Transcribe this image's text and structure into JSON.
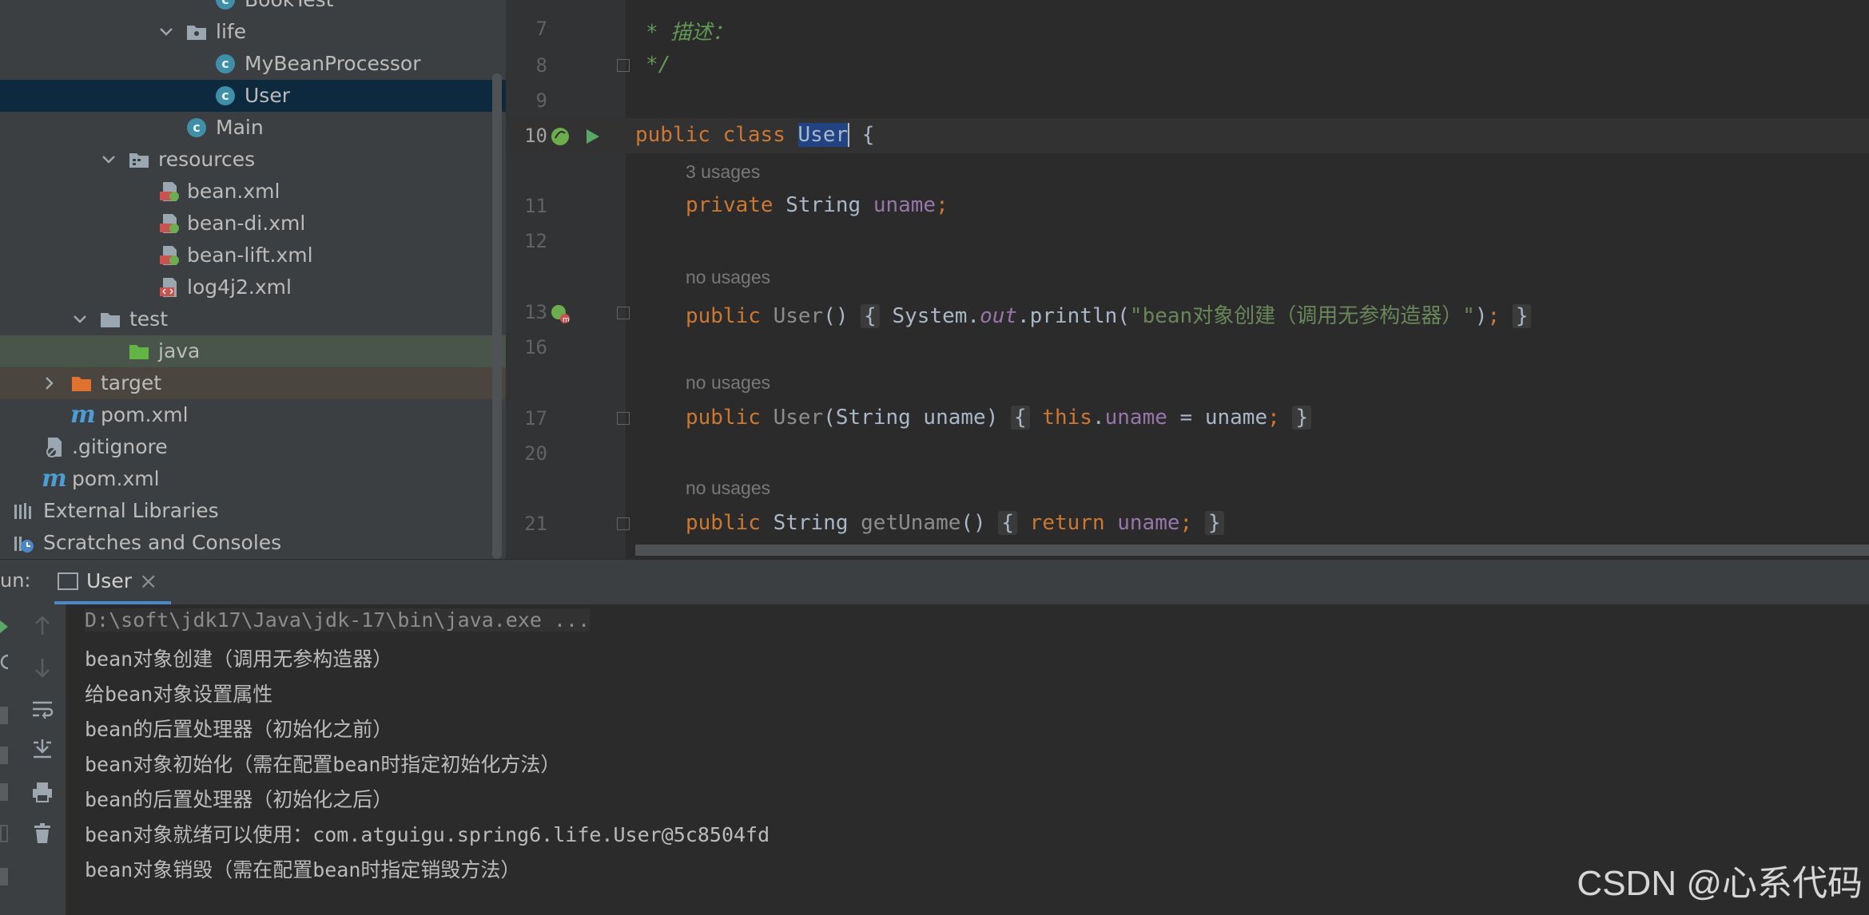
{
  "project_tree": [
    {
      "label": "BookTest",
      "type": "class"
    },
    {
      "label": "life",
      "type": "package",
      "expanded": true
    },
    {
      "label": "MyBeanProcessor",
      "type": "class"
    },
    {
      "label": "User",
      "type": "class",
      "selected": true
    },
    {
      "label": "Main",
      "type": "class"
    },
    {
      "label": "resources",
      "type": "resources-folder",
      "expanded": true
    },
    {
      "label": "bean.xml",
      "type": "spring-xml"
    },
    {
      "label": "bean-di.xml",
      "type": "spring-xml"
    },
    {
      "label": "bean-lift.xml",
      "type": "spring-xml"
    },
    {
      "label": "log4j2.xml",
      "type": "xml"
    },
    {
      "label": "test",
      "type": "folder",
      "expanded": true
    },
    {
      "label": "java",
      "type": "test-source-folder"
    },
    {
      "label": "target",
      "type": "excluded-folder",
      "expanded": false
    },
    {
      "label": "pom.xml",
      "type": "maven"
    },
    {
      "label": ".gitignore",
      "type": "gitignore"
    },
    {
      "label": "pom.xml",
      "type": "maven"
    },
    {
      "label": "External Libraries",
      "type": "libraries"
    },
    {
      "label": "Scratches and Consoles",
      "type": "scratches"
    }
  ],
  "editor": {
    "comment_line1": "* 描述：",
    "comment_line2": "*/",
    "class_decl": {
      "kw1": "public",
      "kw2": "class",
      "name": "User",
      "brace": " {"
    },
    "hints": {
      "usages3": "3 usages",
      "no_usages": "no usages"
    },
    "field_decl": {
      "kw": "private",
      "type": "String",
      "name": "uname",
      "semi": ";"
    },
    "ctor1": {
      "kw": "public",
      "name": "User",
      "params": "()",
      "open": "{",
      "body_obj": "System.",
      "body_field": "out",
      "body_call": ".println(",
      "body_str": "\"bean对象创建（调用无参构造器）\"",
      "close_paren": ")",
      "semi": ";",
      "close": "}"
    },
    "ctor2": {
      "kw": "public",
      "name": "User",
      "params": "(String uname)",
      "open": "{",
      "this_kw": "this",
      "dot": ".",
      "field": "uname",
      "assign": " = uname",
      "semi": ";",
      "close": "}"
    },
    "getter": {
      "kw": "public",
      "type": "String",
      "name": "getUname",
      "params": "()",
      "open": "{",
      "ret": "return",
      "field": "uname",
      "semi": ";",
      "close": "}"
    },
    "line_numbers": [
      "7",
      "8",
      "9",
      "10",
      "11",
      "12",
      "13",
      "16",
      "17",
      "20",
      "21"
    ]
  },
  "run_panel": {
    "label": "un:",
    "tab_label": "User",
    "tab_close": "×",
    "console_lines": [
      "D:\\soft\\jdk17\\Java\\jdk-17\\bin\\java.exe ...",
      "bean对象创建（调用无参构造器）",
      "给bean对象设置属性",
      "bean的后置处理器（初始化之前）",
      "bean对象初始化（需在配置bean时指定初始化方法）",
      "bean的后置处理器（初始化之后）",
      "bean对象就绪可以使用：com.atguigu.spring6.life.User@5c8504fd",
      "bean对象销毁（需在配置bean时指定销毁方法）"
    ]
  },
  "watermark": "CSDN @心系代码",
  "colors": {
    "keyword": "#cc7832",
    "field": "#9876aa",
    "string": "#6a8759",
    "comment": "#629755",
    "selection": "#0d293e"
  }
}
